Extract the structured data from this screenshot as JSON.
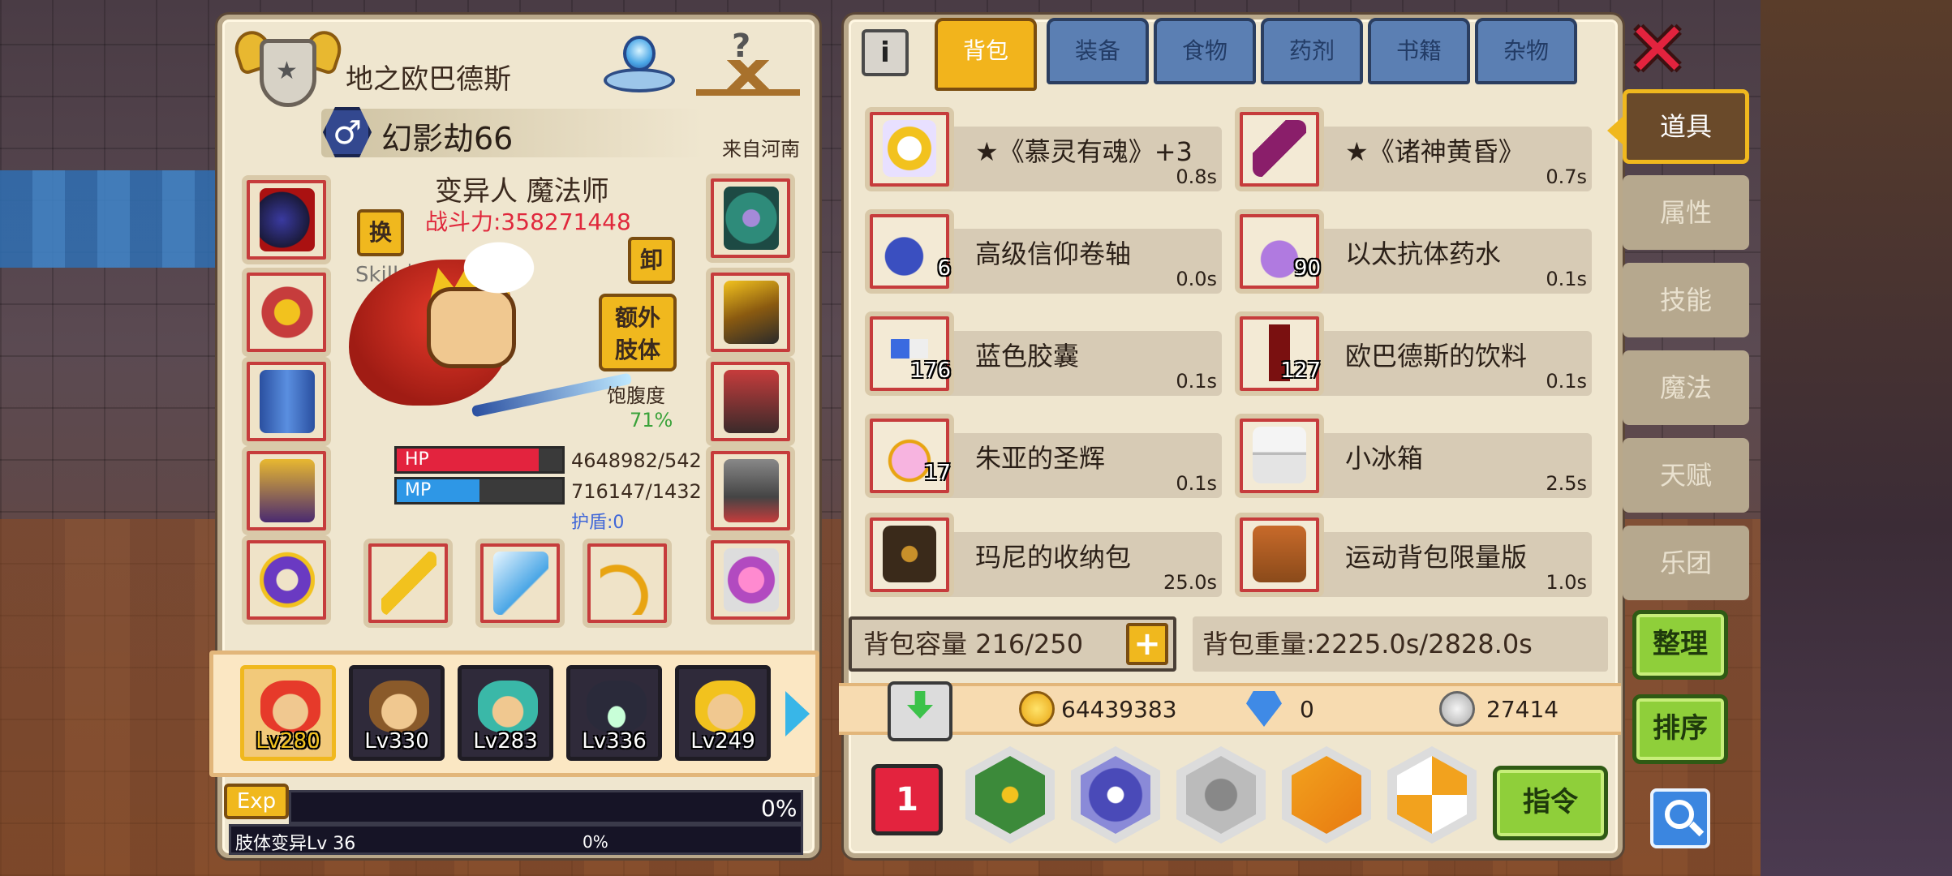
{
  "character": {
    "player_name": "地之欧巴德斯",
    "gender_symbol": "♂",
    "title": "幻影劫66",
    "origin": "来自河南",
    "job": "变异人 魔法师",
    "power": "战斗力:358271448",
    "level_line": "Skill 地狱 Lv 100",
    "swap_label": "换",
    "unload_label": "卸",
    "extra_limb_label": "额外\n肢体",
    "satiety_label": "饱腹度",
    "satiety_value": "71%",
    "hp_label": "HP",
    "mp_label": "MP",
    "hp_text": "4648982/542",
    "mp_text": "716147/1432",
    "hp_fill": 0.86,
    "mp_fill": 0.5,
    "shield_text": "护盾:0"
  },
  "party": [
    {
      "lv": "Lv280",
      "active": true
    },
    {
      "lv": "Lv330",
      "active": false
    },
    {
      "lv": "Lv283",
      "active": false
    },
    {
      "lv": "Lv336",
      "active": false
    },
    {
      "lv": "Lv249",
      "active": false
    }
  ],
  "exp": {
    "label": "Exp",
    "percent": "0%",
    "mutation_label": "肢体变异Lv 36",
    "mutation_percent": "0%"
  },
  "tabs": {
    "info": "i",
    "items": [
      "背包",
      "装备",
      "食物",
      "药剂",
      "书籍",
      "杂物"
    ],
    "active": 0,
    "close": "✕"
  },
  "inventory": [
    {
      "name": "★《慕灵有魂》+3",
      "cd": "0.8s",
      "qty": ""
    },
    {
      "name": "★《诸神黄昏》",
      "cd": "0.7s",
      "qty": ""
    },
    {
      "name": "高级信仰卷轴",
      "cd": "0.0s",
      "qty": "6"
    },
    {
      "name": "以太抗体药水",
      "cd": "0.1s",
      "qty": "90"
    },
    {
      "name": "蓝色胶囊",
      "cd": "0.1s",
      "qty": "176"
    },
    {
      "name": "欧巴德斯的饮料",
      "cd": "0.1s",
      "qty": "127"
    },
    {
      "name": "朱亚的圣辉",
      "cd": "0.1s",
      "qty": "17"
    },
    {
      "name": "小冰箱",
      "cd": "2.5s",
      "qty": ""
    },
    {
      "name": "玛尼的收纳包",
      "cd": "25.0s",
      "qty": ""
    },
    {
      "name": "运动背包限量版",
      "cd": "1.0s",
      "qty": ""
    }
  ],
  "bag": {
    "capacity": "背包容量 216/250",
    "plus": "+",
    "weight": "背包重量:2225.0s/2828.0s"
  },
  "currency": {
    "gold": "64439383",
    "gem": "0",
    "silver": "27414"
  },
  "actions": {
    "slot_label": "1",
    "command": "指令"
  },
  "side_tabs": [
    "道具",
    "属性",
    "技能",
    "魔法",
    "天赋",
    "乐团"
  ],
  "side_buttons": {
    "sort1": "整理",
    "sort2": "排序"
  },
  "colors": {
    "accent": "#f0b81e",
    "tab_blue": "#5b7fb3",
    "hp": "#e3233e",
    "mp": "#2e97e6",
    "power": "#e0283c",
    "green": "#8fcf3a"
  }
}
